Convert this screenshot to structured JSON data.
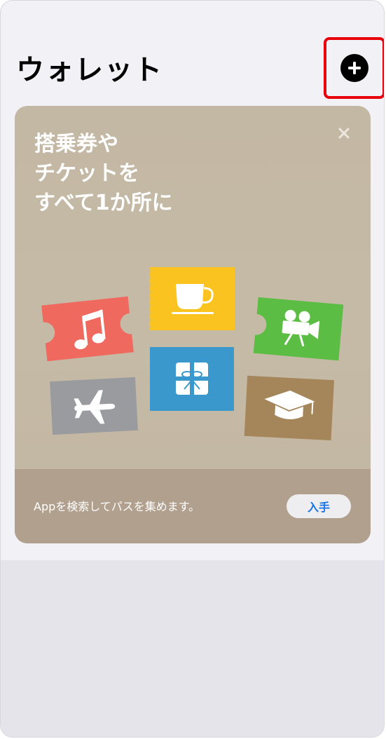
{
  "header": {
    "title": "ウォレット",
    "add_icon": "plus-circle-icon"
  },
  "promo": {
    "headline": [
      "搭乗券や",
      "チケットを",
      "すべて1か所に"
    ],
    "close_icon": "close-icon",
    "tiles": [
      {
        "icon": "music-note-icon",
        "color": "#f0695e"
      },
      {
        "icon": "coffee-cup-icon",
        "color": "#fbc31f"
      },
      {
        "icon": "movie-camera-icon",
        "color": "#5bbd43"
      },
      {
        "icon": "airplane-icon",
        "color": "#9a9b9f"
      },
      {
        "icon": "gift-icon",
        "color": "#3a98cd"
      },
      {
        "icon": "graduation-cap-icon",
        "color": "#a5865a"
      }
    ],
    "footer_text": "Appを検索してパスを集めます。",
    "get_label": "入手"
  },
  "colors": {
    "highlight": "#e8000b",
    "button_text": "#1a73e8"
  }
}
